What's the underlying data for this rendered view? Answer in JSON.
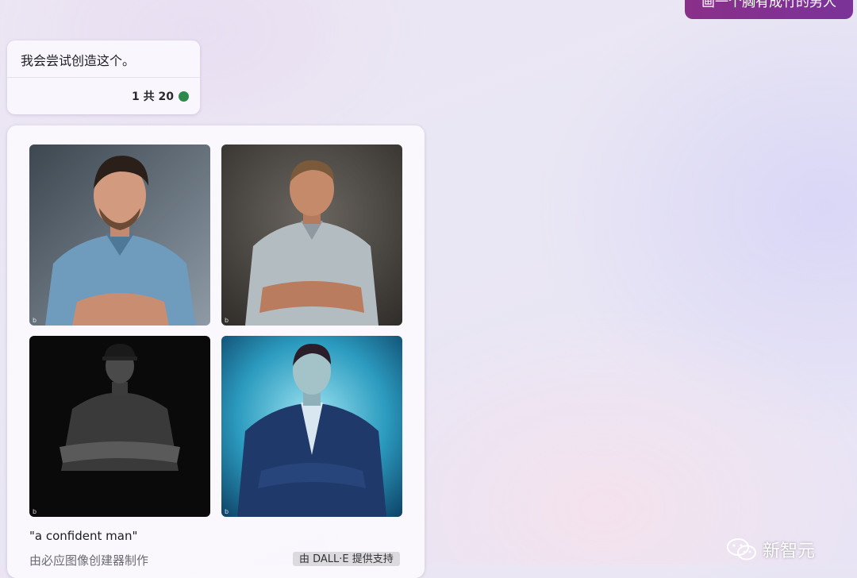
{
  "user_message": {
    "text": "画一个胸有成竹的男人"
  },
  "bot_message": {
    "text": "我会尝试创造这个。",
    "counter": "1 共 20",
    "status_color": "#2e8a4a"
  },
  "image_result": {
    "images": [
      {
        "alt": "bearded man in blue shirt, arms crossed"
      },
      {
        "alt": "man in light shirt, arms crossed, grey background"
      },
      {
        "alt": "man in cap and black t-shirt, arms crossed, dark background"
      },
      {
        "alt": "man in suit, arms crossed, blue background"
      }
    ],
    "prompt": "\"a confident man\"",
    "creator": "由必应图像创建器制作",
    "powered_by": "由 DALL·E 提供支持"
  },
  "watermark": {
    "text": "新智元",
    "icon": "wechat-icon"
  },
  "colors": {
    "user_bubble": "#8a2f8a",
    "accent_dot": "#2e8a4a"
  }
}
